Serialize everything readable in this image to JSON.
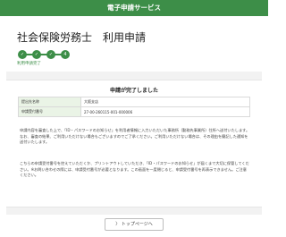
{
  "header": {
    "title": "電子申請サービス"
  },
  "page": {
    "title": "社会保険労務士　利用申請"
  },
  "steps": {
    "items": [
      "✓",
      "✓",
      "✓",
      "4"
    ],
    "label": "利用申請完了"
  },
  "card": {
    "title": "申請が完了しました",
    "rows": [
      {
        "label": "提出先名称",
        "value": "大阪支店"
      },
      {
        "label": "申請受付番号",
        "value": "27-00-260115-001-000006"
      }
    ]
  },
  "messages": {
    "para1": "申請内容を審査した上で、「ID・パスワードのお知らせ」を利用者情報に入力いただいた事務所（勤務先事業所）住所へ送付いたします。なお、審査の結果、ご利用いただけない場合もございますのでご了承ください。ご利用いただけない場合は、その理由を簡記した通知を送付いたします。",
    "para2": "こちらの申請受付番号を控えていただくか、プリントアウトしていただき、「ID・パスワードのお知らせ」が届くまで大切に保管してください。※お問い合わせの際には、申請受付番号が必要となります。この画面を一度閉じると、申請受付番号を再表示できません。ご注意ください。"
  },
  "button": {
    "label": "〉 トップページへ"
  }
}
